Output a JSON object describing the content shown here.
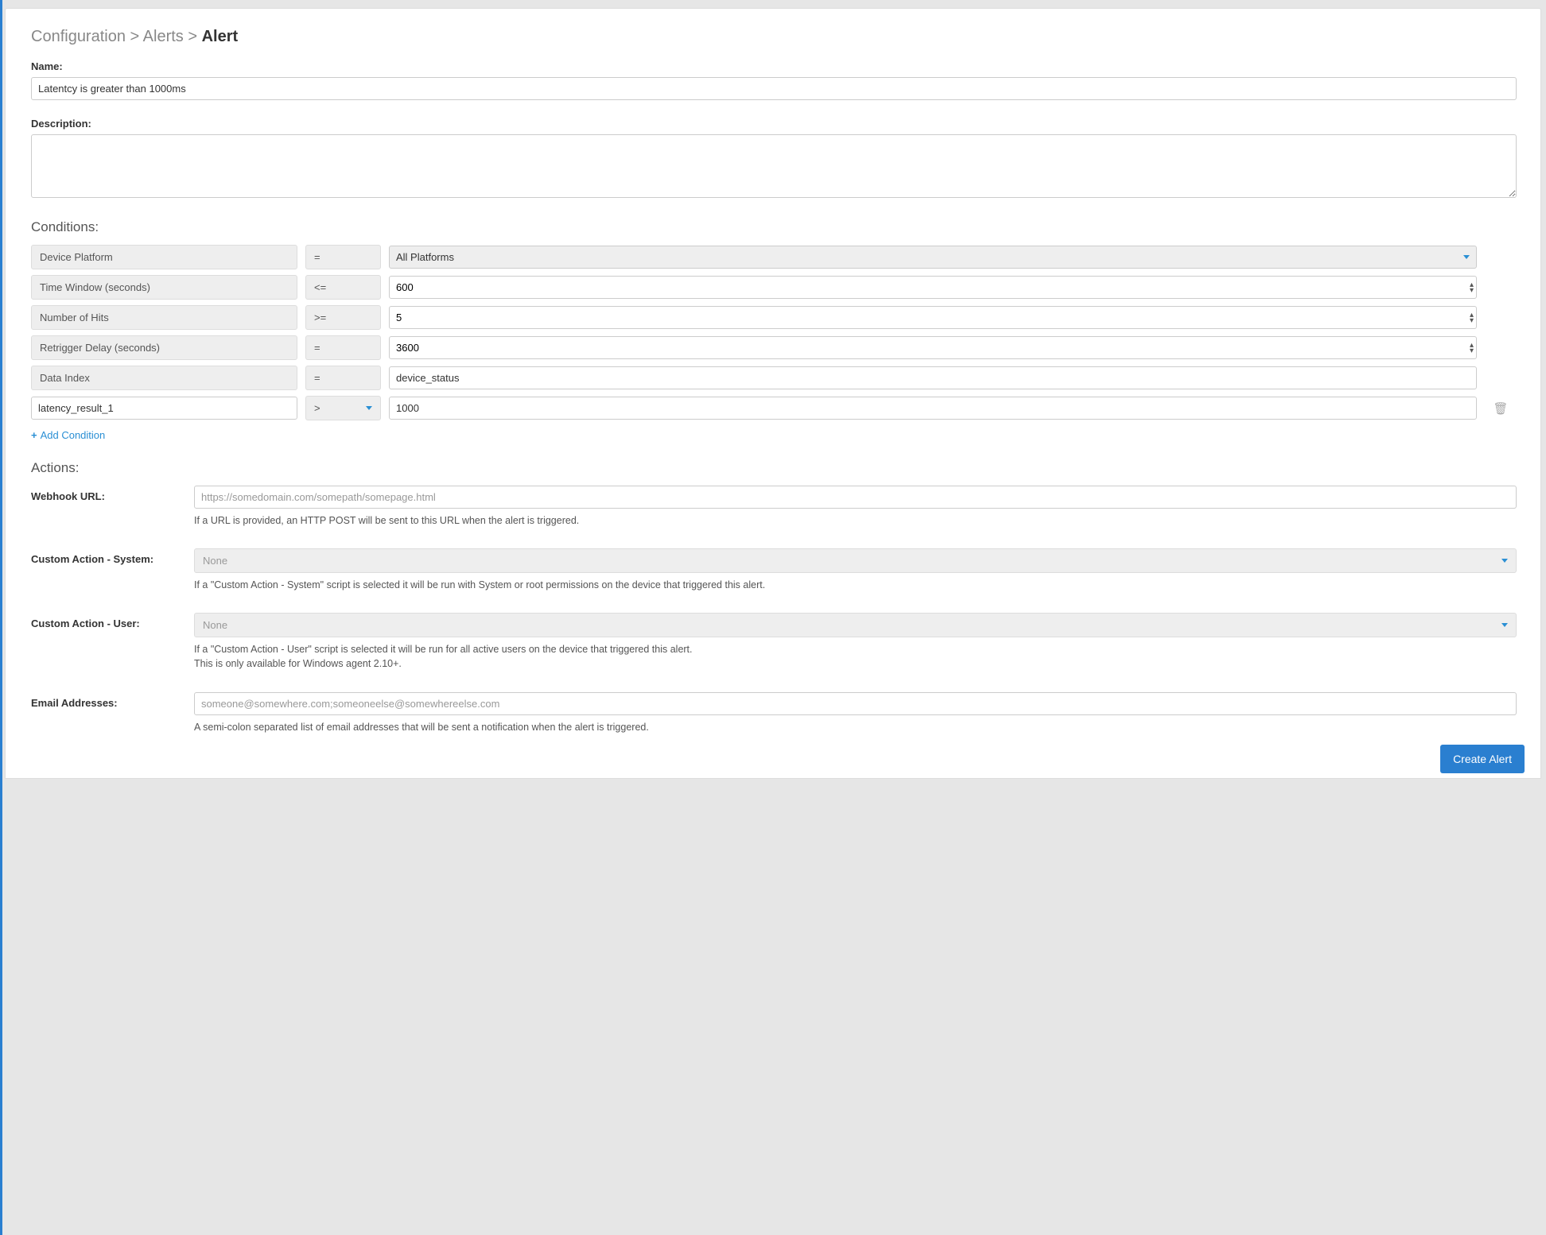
{
  "breadcrumb": {
    "part1": "Configuration",
    "sep": ">",
    "part2": "Alerts",
    "current": "Alert"
  },
  "labels": {
    "name": "Name:",
    "description": "Description:",
    "conditions_heading": "Conditions:",
    "actions_heading": "Actions:",
    "webhook": "Webhook URL:",
    "custom_system": "Custom Action - System:",
    "custom_user": "Custom Action - User:",
    "email": "Email Addresses:"
  },
  "name_value": "Latentcy is greater than 1000ms",
  "description_value": "",
  "conditions": {
    "row0": {
      "label": "Device Platform",
      "op": "=",
      "value": "All Platforms"
    },
    "row1": {
      "label": "Time Window (seconds)",
      "op": "<=",
      "value": "600"
    },
    "row2": {
      "label": "Number of Hits",
      "op": ">=",
      "value": "5"
    },
    "row3": {
      "label": "Retrigger Delay (seconds)",
      "op": "=",
      "value": "3600"
    },
    "row4": {
      "label": "Data Index",
      "op": "=",
      "value": "device_status"
    },
    "row5": {
      "field": "latency_result_1",
      "op": ">",
      "value": "1000"
    }
  },
  "add_condition_label": "Add Condition",
  "actions": {
    "webhook_placeholder": "https://somedomain.com/somepath/somepage.html",
    "webhook_help": "If a URL is provided, an HTTP POST will be sent to this URL when the alert is triggered.",
    "none_label": "None",
    "custom_system_help": "If a \"Custom Action - System\" script is selected it will be run with System or root permissions on the device that triggered this alert.",
    "custom_user_help_line1": "If a \"Custom Action - User\" script is selected it will be run for all active users on the device that triggered this alert.",
    "custom_user_help_line2": "This is only available for Windows agent 2.10+.",
    "email_placeholder": "someone@somewhere.com;someoneelse@somewhereelse.com",
    "email_help": "A semi-colon separated list of email addresses that will be sent a notification when the alert is triggered."
  },
  "create_button": "Create Alert"
}
